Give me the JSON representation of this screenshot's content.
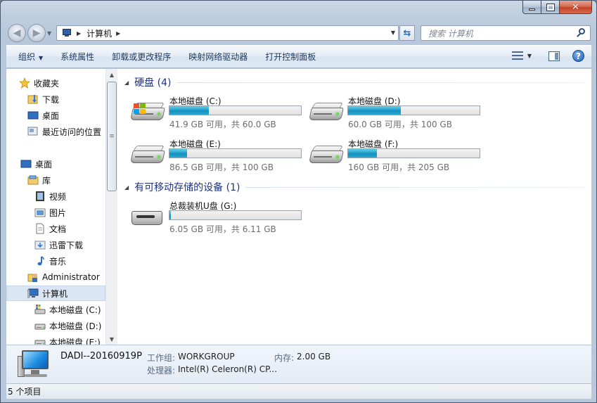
{
  "window": {
    "title": ""
  },
  "address": {
    "crumbs": [
      "计算机"
    ],
    "search_placeholder": "搜索 计算机"
  },
  "commands": {
    "organize": "组织",
    "system_properties": "系统属性",
    "uninstall": "卸载或更改程序",
    "map_drive": "映射网络驱动器",
    "control_panel": "打开控制面板"
  },
  "sidebar": {
    "favorites": "收藏夹",
    "downloads": "下载",
    "desktop_fav": "桌面",
    "recent": "最近访问的位置",
    "desktop": "桌面",
    "library": "库",
    "videos": "视频",
    "pictures": "图片",
    "documents": "文档",
    "xunlei": "迅雷下载",
    "music": "音乐",
    "admin": "Administrator",
    "computer": "计算机",
    "drive_c": "本地磁盘 (C:)",
    "drive_d": "本地磁盘 (D:)",
    "drive_e": "本地磁盘 (E:)"
  },
  "content": {
    "hdd_group": "硬盘 (4)",
    "removable_group": "有可移动存储的设备 (1)",
    "drives": [
      {
        "name": "本地磁盘 (C:)",
        "size": "41.9 GB 可用，共 60.0 GB",
        "used_fraction": 0.302
      },
      {
        "name": "本地磁盘 (D:)",
        "size": "60.0 GB 可用，共 100 GB",
        "used_fraction": 0.4
      },
      {
        "name": "本地磁盘 (E:)",
        "size": "86.5 GB 可用，共 100 GB",
        "used_fraction": 0.135
      },
      {
        "name": "本地磁盘 (F:)",
        "size": "160 GB 可用，共 205 GB",
        "used_fraction": 0.22
      }
    ],
    "usb": {
      "name": "总裁装机U盘 (G:)",
      "size": "6.05 GB 可用，共 6.11 GB",
      "used_fraction": 0.01
    }
  },
  "details": {
    "computer_name": "DADI--20160919P",
    "workgroup_label": "工作组:",
    "workgroup_value": "WORKGROUP",
    "memory_label": "内存:",
    "memory_value": "2.00 GB",
    "cpu_label": "处理器:",
    "cpu_value": "Intel(R) Celeron(R) CP..."
  },
  "status": {
    "count": "5 个项目"
  },
  "colors": {
    "accent": "#1e3287",
    "bar_fill": "#26a0c9"
  }
}
